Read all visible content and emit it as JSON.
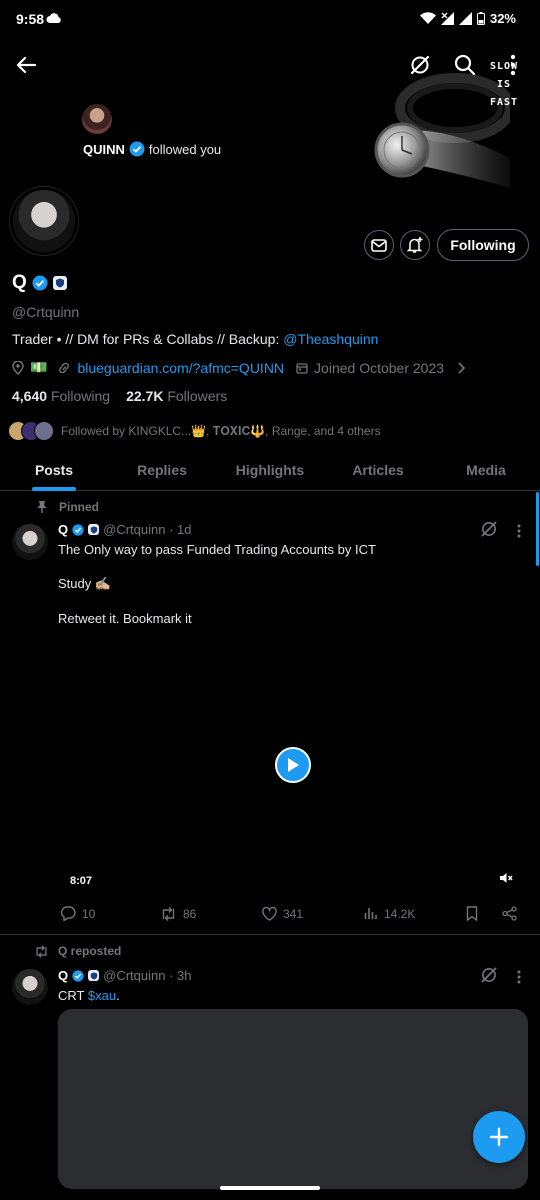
{
  "status_bar": {
    "time": "9:58",
    "battery": "32%"
  },
  "banner": {
    "text_line1": "SLOW",
    "text_line2": "IS",
    "text_line3": "FAST"
  },
  "followed_notice": {
    "name": "QUINN",
    "text": "followed you"
  },
  "profile": {
    "name": "Q",
    "handle": "@Crtquinn",
    "bio_text": "Trader • // DM for PRs & Collabs // Backup: ",
    "bio_link": "@Theashquinn",
    "location_emoji": "💵",
    "website": "blueguardian.com/?afmc=QUINN",
    "joined": "Joined October 2023",
    "following_count": "4,640",
    "following_label": "Following",
    "followers_count": "22.7K",
    "followers_label": "Followers",
    "followed_by": "Followed by KINGKLC...👑, 𝐓𝐎𝐗𝐈𝐂🔱, Range, and 4 others",
    "following_button": "Following"
  },
  "tabs": [
    {
      "label": "Posts",
      "active": true
    },
    {
      "label": "Replies",
      "active": false
    },
    {
      "label": "Highlights",
      "active": false
    },
    {
      "label": "Articles",
      "active": false
    },
    {
      "label": "Media",
      "active": false
    }
  ],
  "pinned_post": {
    "pinned_label": "Pinned",
    "name": "Q",
    "handle_time": "@Crtquinn · 1d",
    "line1": "The Only way to pass Funded Trading Accounts by ICT",
    "line2": "Study ✍🏼",
    "line3": "Retweet it. Bookmark it",
    "video_duration": "8:07",
    "replies": "10",
    "reposts": "86",
    "likes": "341",
    "views": "14.2K"
  },
  "repost": {
    "repost_label": "Q reposted",
    "name": "Q",
    "handle_time": "@Crtquinn · 3h",
    "text": "CRT ",
    "cashtag": "$xau",
    "text_end": "."
  },
  "colors": {
    "accent": "#1d9bf0",
    "background": "#000000",
    "muted": "#71767b",
    "border": "#2f3336"
  },
  "icons": [
    "back-arrow-icon",
    "grok-icon",
    "search-icon",
    "more-icon",
    "mail-icon",
    "bell-plus-icon",
    "location-icon",
    "link-icon",
    "calendar-icon",
    "pin-icon",
    "reply-icon",
    "repost-icon",
    "like-icon",
    "views-icon",
    "bookmark-icon",
    "share-icon",
    "play-icon",
    "mute-icon",
    "compose-icon"
  ]
}
